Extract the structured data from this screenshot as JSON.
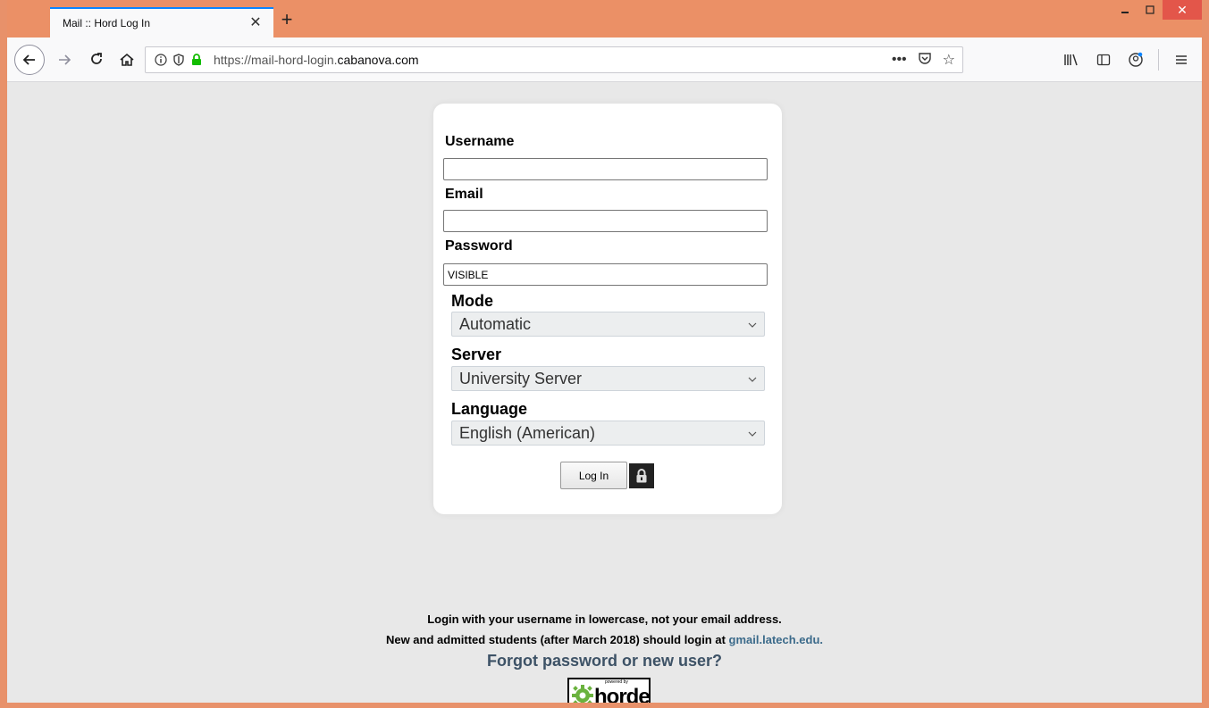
{
  "browser": {
    "tab_title": "Mail :: Hord Log In",
    "url_prefix": "https://mail-hord-login.",
    "url_domain": "cabanova.com"
  },
  "form": {
    "username_label": "Username",
    "username_value": "",
    "email_label": "Email",
    "email_value": "",
    "password_label": "Password",
    "password_value": "VISIBLE",
    "mode_label": "Mode",
    "mode_value": "Automatic",
    "server_label": "Server",
    "server_value": "University Server",
    "language_label": "Language",
    "language_value": "English (American)",
    "login_label": "Log In"
  },
  "footer": {
    "line1": "Login with your username in lowercase, not your email address.",
    "line2": "New and admitted students (after March 2018) should login at ",
    "line2_link": "gmail.latech.edu.",
    "forgot": "Forgot password or new user?",
    "logo_small": "powered by",
    "logo_word": "horde"
  },
  "colors": {
    "accent": "#0a84ff",
    "frame": "#e8916a",
    "close_button": "#e3564a",
    "page_bg": "#e8e8e8",
    "link": "#3b6a8a"
  }
}
